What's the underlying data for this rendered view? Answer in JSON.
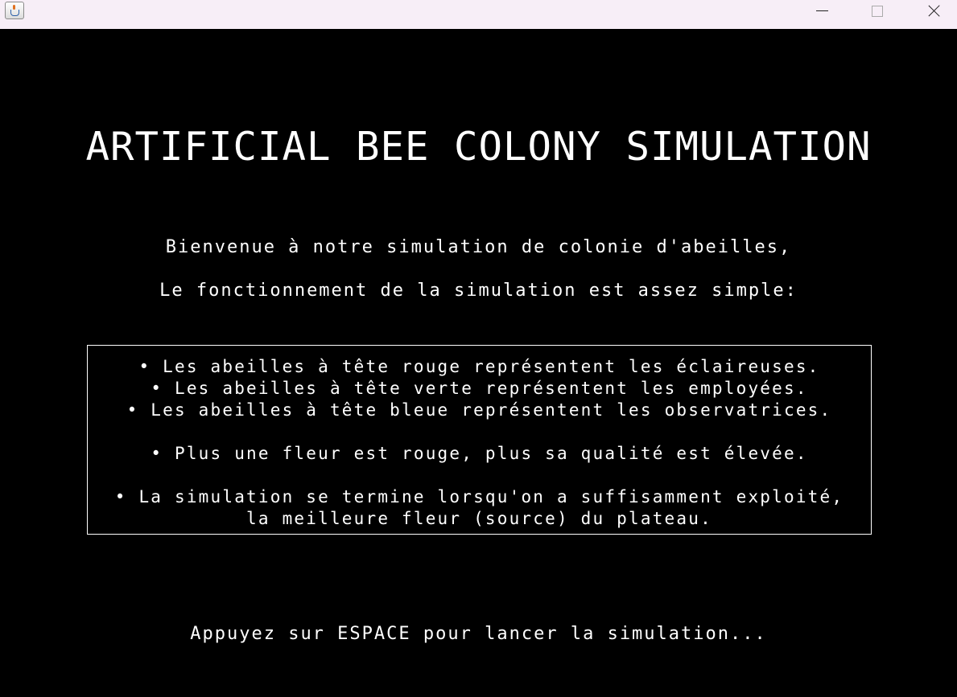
{
  "window": {
    "app_icon": "java-cup-icon",
    "controls": {
      "minimize": "minimize-icon",
      "maximize": "maximize-icon",
      "close": "close-icon"
    }
  },
  "screen": {
    "title": "ARTIFICIAL BEE COLONY SIMULATION",
    "intro_line_1": "Bienvenue à notre simulation de colonie d'abeilles,",
    "intro_line_2": "Le fonctionnement de la simulation est assez simple:",
    "rules": [
      "• Les abeilles à tête rouge représentent les éclaireuses.",
      "• Les abeilles à tête verte représentent les employées.",
      "• Les abeilles à tête bleue représentent les observatrices.",
      "• Plus une fleur est rouge, plus sa qualité est élevée.",
      "• La simulation se termine lorsqu'on a suffisamment exploité,",
      "la meilleure fleur (source) du plateau."
    ],
    "prompt": "Appuyez sur ESPACE pour lancer la simulation..."
  },
  "colors": {
    "background": "#000000",
    "text": "#ffffff",
    "titlebar": "#f7eef7"
  }
}
